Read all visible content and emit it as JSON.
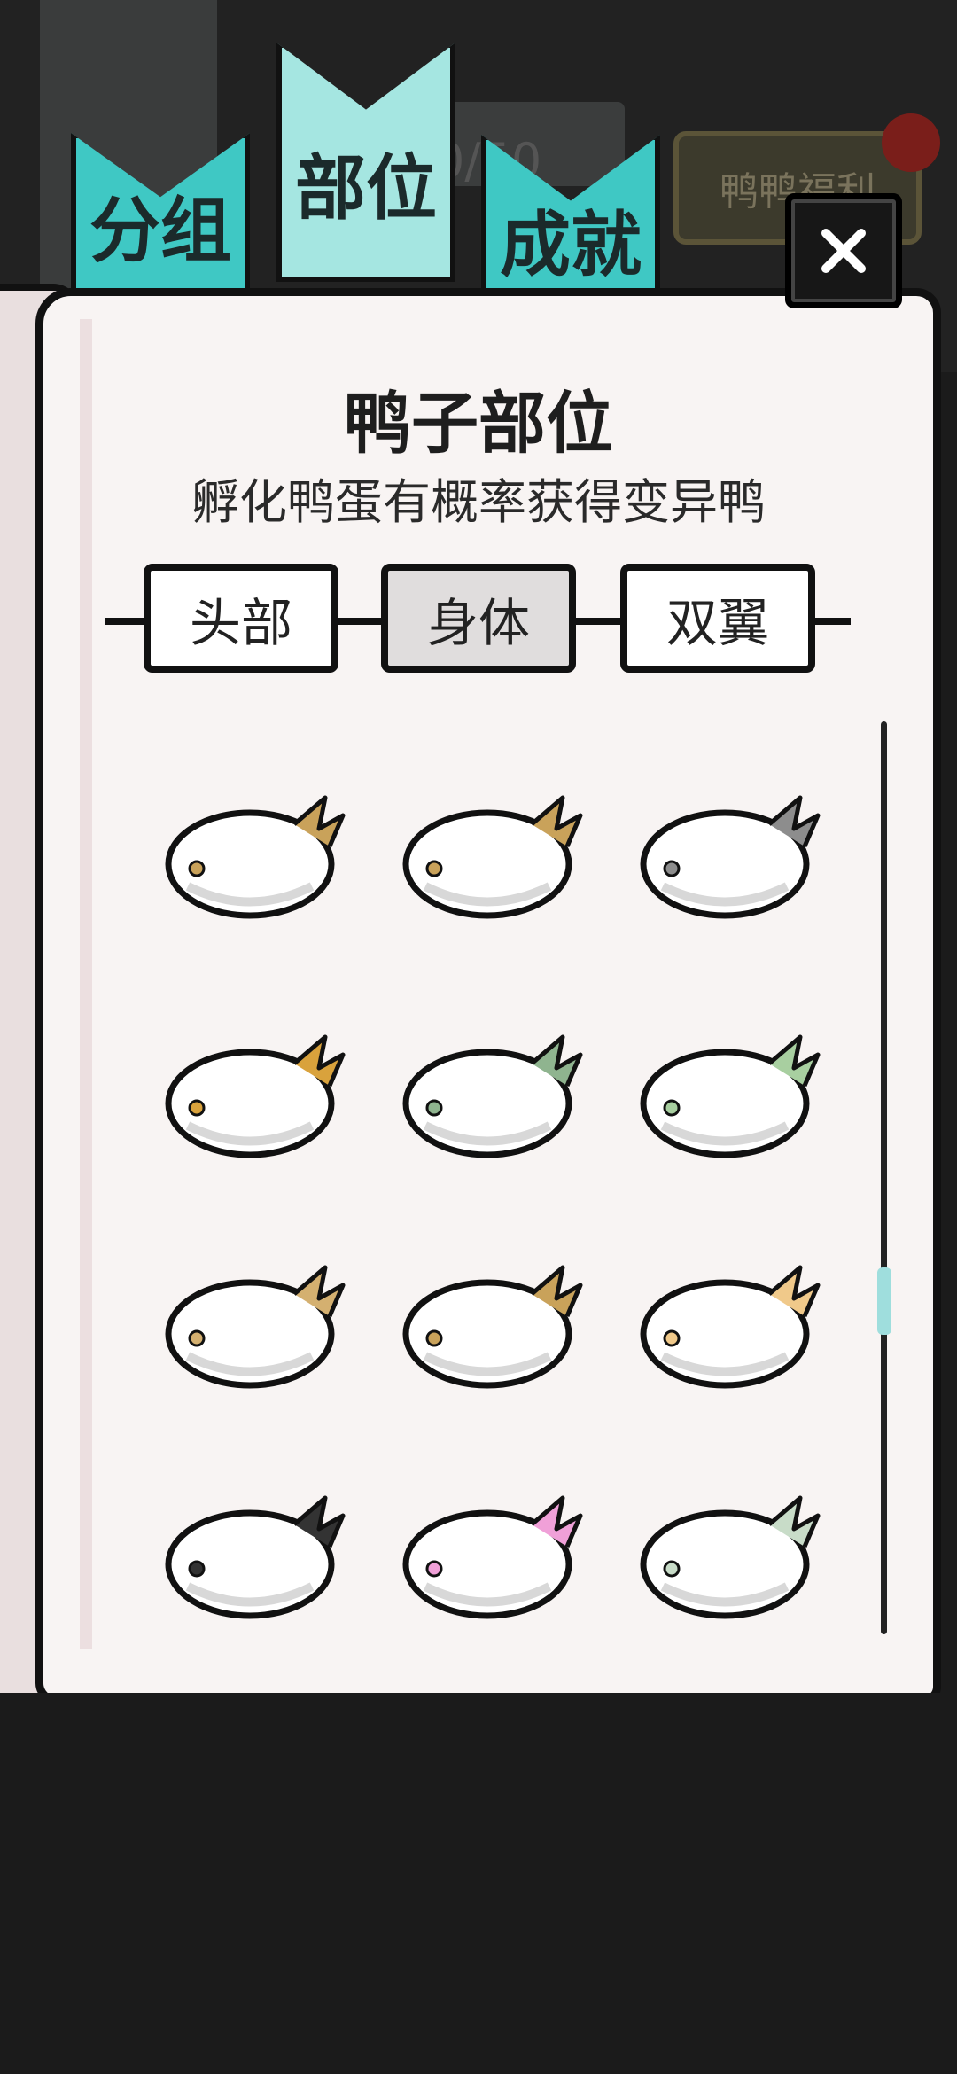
{
  "tabs": [
    {
      "label": "分组",
      "active": false
    },
    {
      "label": "部位",
      "active": true
    },
    {
      "label": "成就",
      "active": false
    }
  ],
  "background": {
    "welfare_label": "鸭鸭福利",
    "faint_counter": "0/50"
  },
  "page": {
    "title": "鸭子部位",
    "subtitle": "孵化鸭蛋有概率获得变异鸭"
  },
  "categories": [
    {
      "label": "头部",
      "selected": false
    },
    {
      "label": "身体",
      "selected": true
    },
    {
      "label": "双翼",
      "selected": false
    }
  ],
  "scroll_position": 0.6,
  "items": [
    {
      "name": "body-white-tuft-gem"
    },
    {
      "name": "body-gold-tail"
    },
    {
      "name": "body-gray-scythe-tail"
    },
    {
      "name": "body-gold-flame-belt"
    },
    {
      "name": "body-green-cape"
    },
    {
      "name": "body-potion-collar"
    },
    {
      "name": "body-feathered-gold"
    },
    {
      "name": "body-speckled-gold-tail"
    },
    {
      "name": "body-checker-wing"
    },
    {
      "name": "body-spiked-black"
    },
    {
      "name": "body-pink-flower-tail"
    },
    {
      "name": "body-green-leaf-tail"
    }
  ],
  "colors": {
    "tab_active": "#a5e6e1",
    "tab_inactive": "#3fc8c4",
    "page_bg": "#f8f4f3",
    "scroll_thumb": "#9fdedd"
  }
}
